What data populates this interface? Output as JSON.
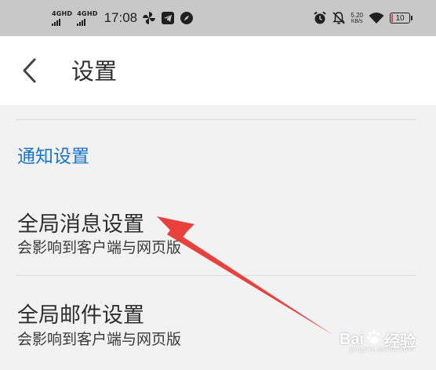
{
  "status_bar": {
    "network_1": "4GHD",
    "network_2": "4GHD",
    "time": "17:08",
    "net_speed_value": "5.20",
    "net_speed_unit": "KB/s",
    "battery_level": "10",
    "icons": [
      "pinwheel-icon",
      "telegram-icon",
      "compass-icon",
      "alarm-icon",
      "bell-muted-icon",
      "wifi-icon",
      "battery-icon"
    ],
    "battery_color": "#e0474a"
  },
  "app_bar": {
    "back_icon": "chevron-left-icon",
    "title": "设置"
  },
  "section": {
    "header": "通知设置",
    "header_color": "#1a73c8"
  },
  "settings": [
    {
      "title": "全局消息设置",
      "subtitle": "会影响到客户端与网页版"
    },
    {
      "title": "全局邮件设置",
      "subtitle": "会影响到客户端与网页版"
    }
  ],
  "annotation": {
    "arrow_color": "#e8413c"
  },
  "watermark": {
    "brand_left": "Bai",
    "brand_right": "经验",
    "sub": "jingyan.baidu.com"
  }
}
